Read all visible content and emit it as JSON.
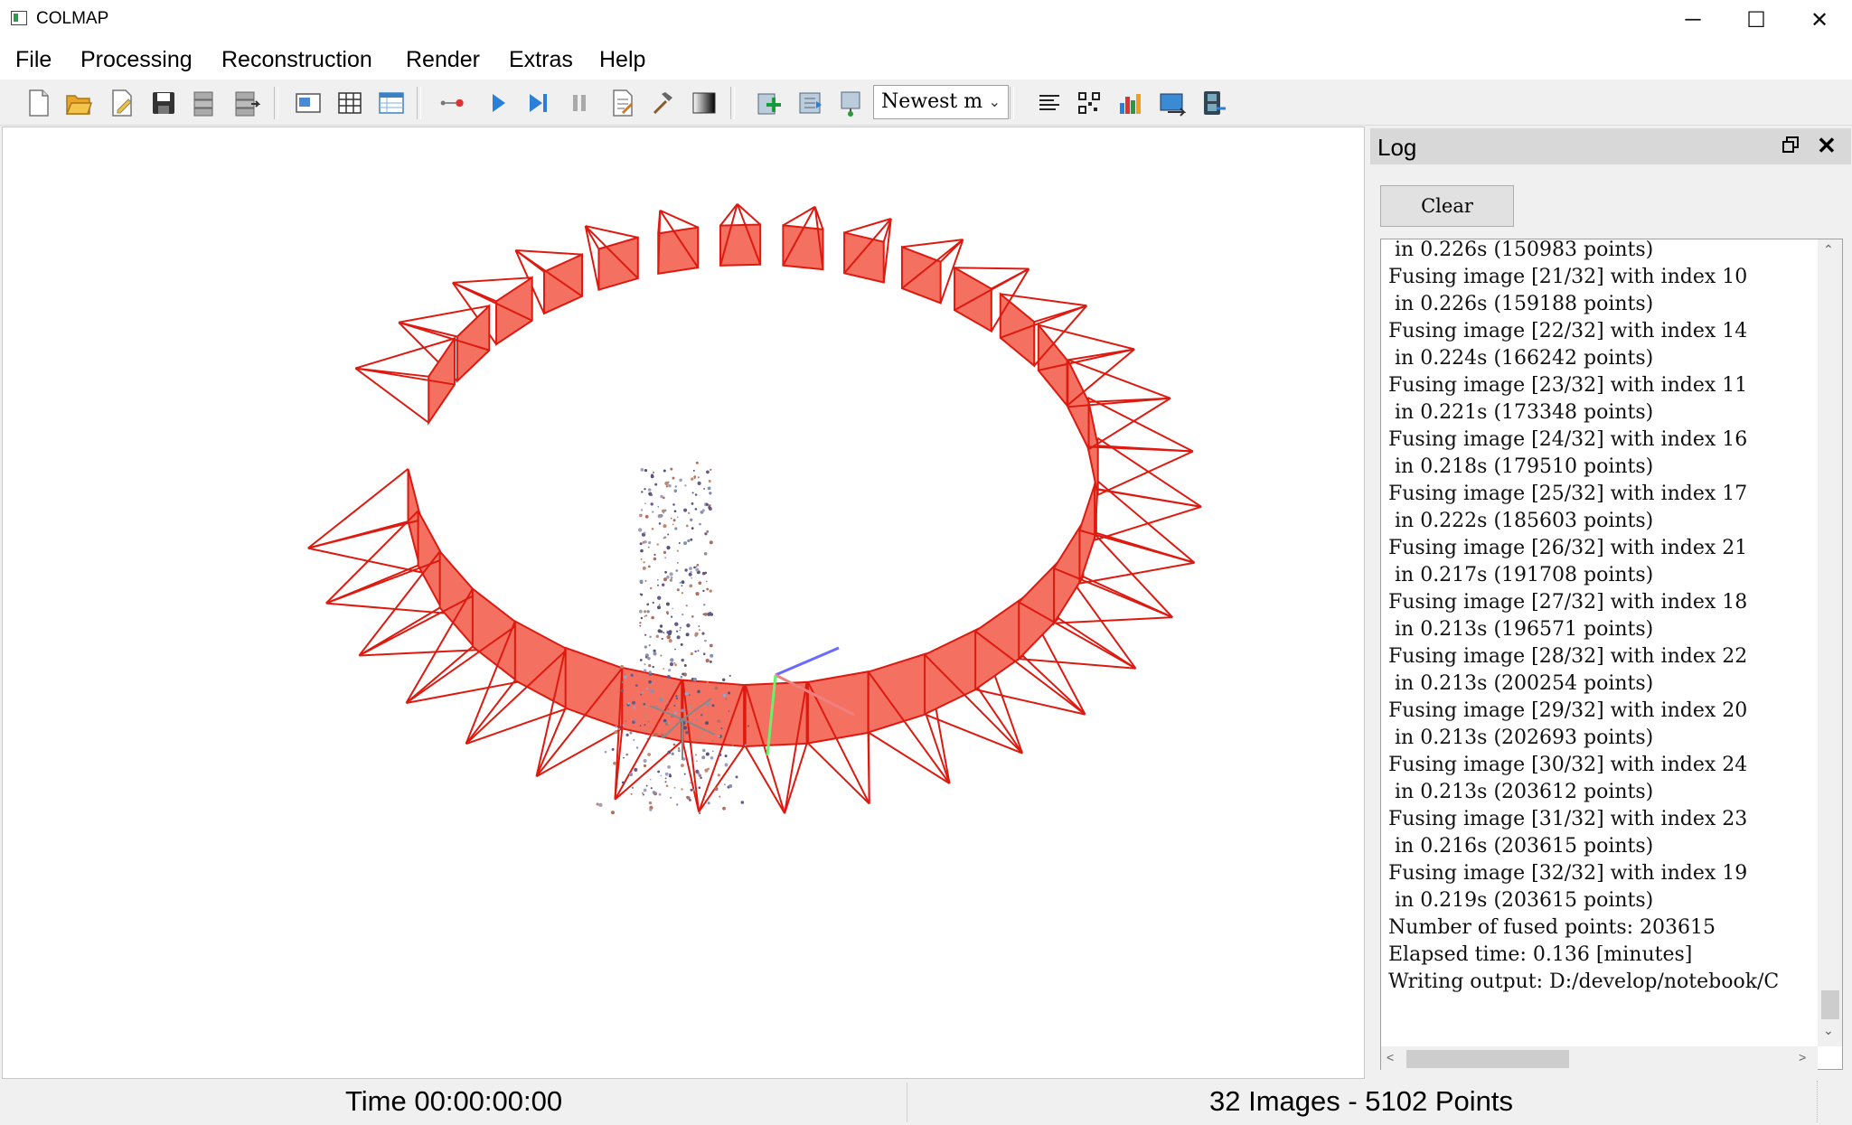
{
  "window": {
    "title": "COLMAP",
    "minimize": "─",
    "maximize": "☐",
    "close": "✕"
  },
  "menu": [
    "File",
    "Processing",
    "Reconstruction",
    "Render",
    "Extras",
    "Help"
  ],
  "toolbar": {
    "render_options_select": "Newest m",
    "icons": [
      "new-project-icon",
      "open-project-icon",
      "edit-project-icon",
      "save-project-icon",
      "import-model-icon",
      "export-model-icon",
      "feature-extraction-icon",
      "feature-matching-icon",
      "database-management-icon",
      "automatic-reconstruction-icon",
      "start-reconstruction-icon",
      "step-reconstruction-icon",
      "pause-reconstruction-icon",
      "reconstruction-options-icon",
      "bundle-adjustment-icon",
      "dense-reconstruction-icon",
      "render-options-icon",
      "reset-view-icon",
      "grab-image-icon",
      "grab-movie-icon",
      "log-icon",
      "match-matrix-icon",
      "reconstruction-stats-icon",
      "undistort-icon",
      "movie-grabber-icon"
    ]
  },
  "log": {
    "title": "Log",
    "clear_label": "Clear",
    "lines": [
      " in 0.226s (150983 points)",
      "Fusing image [21/32] with index 10",
      " in 0.226s (159188 points)",
      "Fusing image [22/32] with index 14",
      " in 0.224s (166242 points)",
      "Fusing image [23/32] with index 11",
      " in 0.221s (173348 points)",
      "Fusing image [24/32] with index 16",
      " in 0.218s (179510 points)",
      "Fusing image [25/32] with index 17",
      " in 0.222s (185603 points)",
      "Fusing image [26/32] with index 21",
      " in 0.217s (191708 points)",
      "Fusing image [27/32] with index 18",
      " in 0.213s (196571 points)",
      "Fusing image [28/32] with index 22",
      " in 0.213s (200254 points)",
      "Fusing image [29/32] with index 20",
      " in 0.213s (202693 points)",
      "Fusing image [30/32] with index 24",
      " in 0.213s (203612 points)",
      "Fusing image [31/32] with index 23",
      " in 0.216s (203615 points)",
      "Fusing image [32/32] with index 19",
      " in 0.219s (203615 points)",
      "Number of fused points: 203615",
      "Elapsed time: 0.136 [minutes]",
      "Writing output: D:/develop/notebook/C"
    ]
  },
  "status": {
    "time": "Time 00:00:00:00",
    "counts": "32 Images - 5102 Points"
  },
  "viewer": {
    "camera_color": "#dd1a10",
    "camera_fill": "#f47060",
    "camera_count": 32
  }
}
